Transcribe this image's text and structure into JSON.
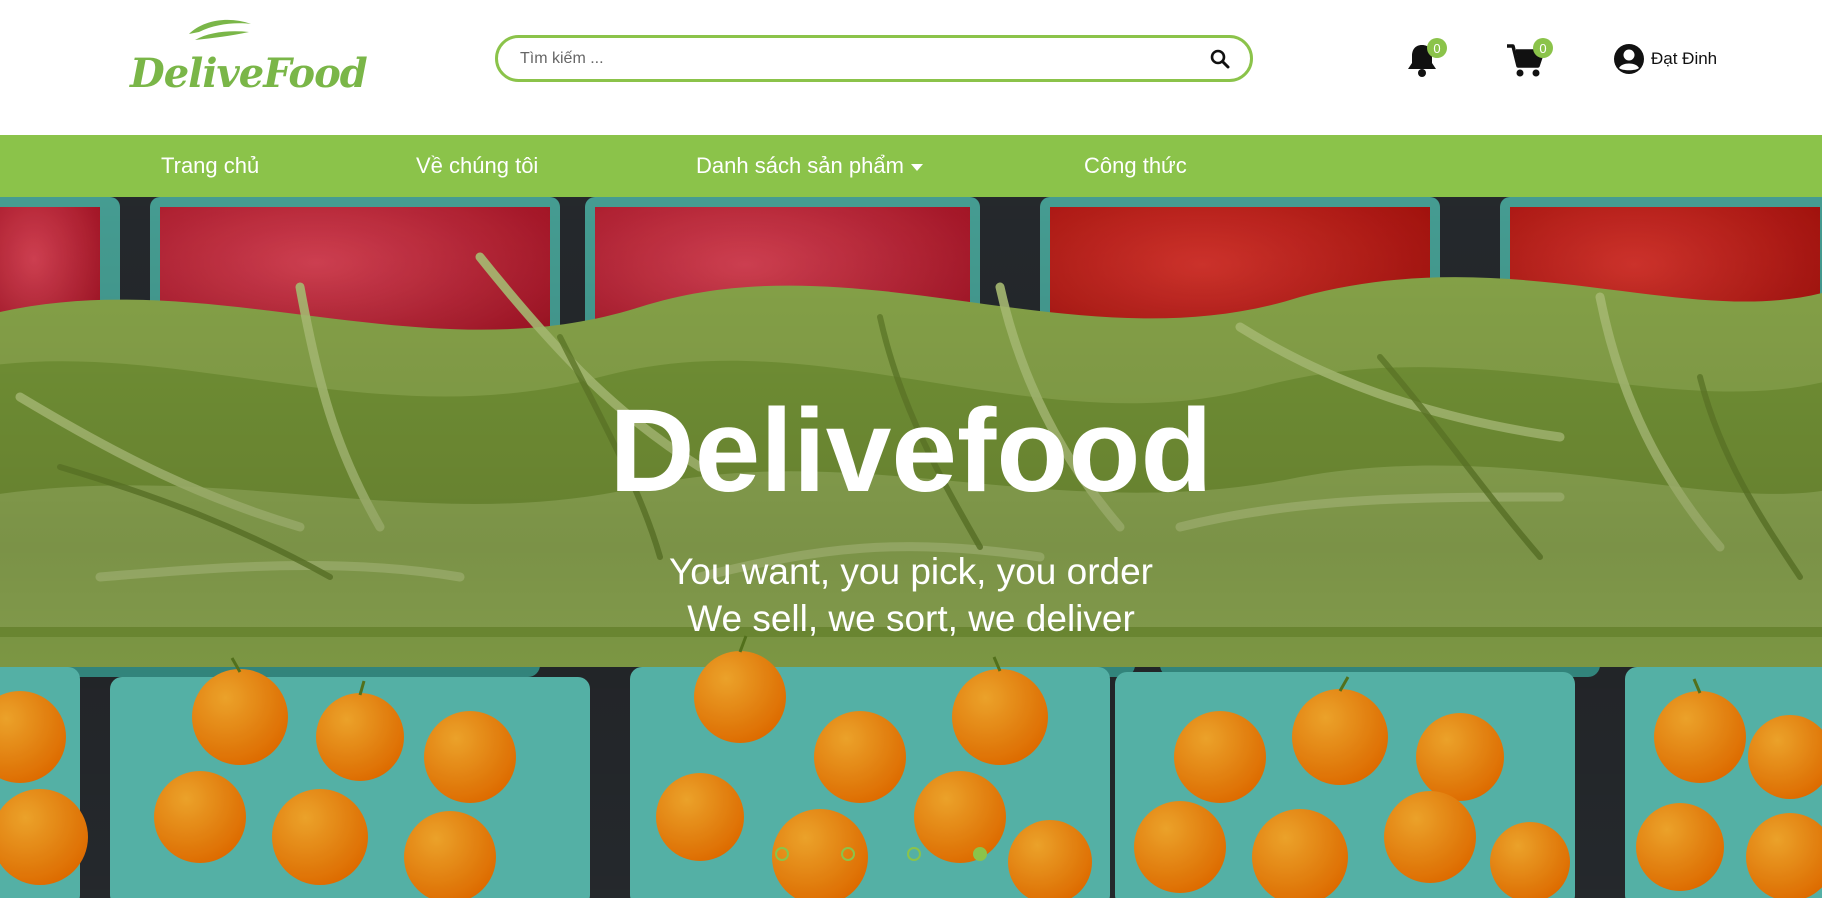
{
  "brand": {
    "logo_text": "DeliveFood",
    "accent_color": "#8bc34a"
  },
  "search": {
    "placeholder": "Tìm kiếm ...",
    "value": "",
    "icon": "search-icon"
  },
  "notifications": {
    "count": "0",
    "icon": "bell-icon"
  },
  "cart": {
    "count": "0",
    "icon": "cart-icon"
  },
  "user": {
    "name": "Đạt Đinh",
    "icon": "user-circle-icon"
  },
  "nav": {
    "items": [
      {
        "label": "Trang chủ"
      },
      {
        "label": "Về chúng tôi"
      },
      {
        "label": "Danh sách sản phẩm",
        "has_dropdown": true
      },
      {
        "label": "Công thức"
      }
    ]
  },
  "hero": {
    "title": "Delivefood",
    "line1": "You want, you pick, you order",
    "line2": "We sell, we sort, we deliver",
    "slides": 4,
    "active_slide": 4
  }
}
